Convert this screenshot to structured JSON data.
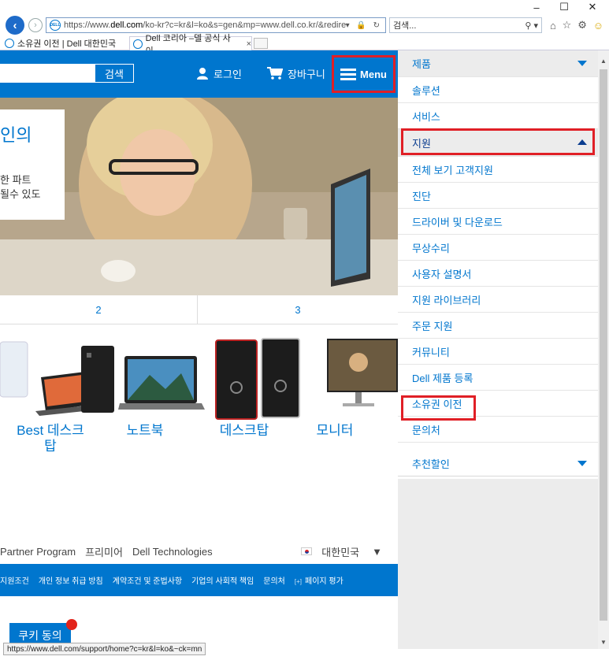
{
  "browser": {
    "url_prefix": "https://www.",
    "url_domain": "dell.com",
    "url_rest": "/ko-kr?c=kr&l=ko&s=gen&mp=www.dell.co.kr/&redirect=1#",
    "search_placeholder": "검색...",
    "window_controls": {
      "minimize": "–",
      "maximize": "☐",
      "close": "✕"
    },
    "tabs": [
      {
        "label": "소유권 이전 | Dell 대한민국"
      },
      {
        "label": "Dell 코리아 –델 공식 사이..."
      }
    ],
    "status_url": "https://www.dell.com/support/home?c=kr&l=ko&~ck=mn"
  },
  "header": {
    "search_button": "검색",
    "login": "로그인",
    "cart": "장바구니",
    "menu": "Menu"
  },
  "hero": {
    "title": "인의",
    "text": "한 파트\n될수 있도"
  },
  "carousel": {
    "items": [
      "2",
      "3"
    ]
  },
  "products": [
    {
      "label": "Best 데스크\n탑"
    },
    {
      "label": "노트북"
    },
    {
      "label": "데스크탑"
    },
    {
      "label": "모니터"
    }
  ],
  "footer": {
    "links_top": [
      "Partner Program",
      "프리미어",
      "Dell Technologies"
    ],
    "region": "대한민국",
    "links_bottom": [
      "지원조건",
      "개인 정보 취급 방침",
      "계약조건 및 준법사항",
      "기업의 사회적 책임",
      "문의처",
      "페이지 평가"
    ],
    "feedback_icon": "[+]"
  },
  "cookie": {
    "label": "쿠키 동의"
  },
  "menu": {
    "top_items": [
      {
        "label": "제품"
      },
      {
        "label": "솔루션"
      },
      {
        "label": "서비스"
      },
      {
        "label": "지원"
      }
    ],
    "support_items": [
      {
        "label": "전체 보기 고객지원"
      },
      {
        "label": "진단"
      },
      {
        "label": "드라이버 및 다운로드"
      },
      {
        "label": "무상수리"
      },
      {
        "label": "사용자 설명서"
      },
      {
        "label": "지원 라이브러리"
      },
      {
        "label": "주문 지원"
      },
      {
        "label": "커뮤니티"
      },
      {
        "label": "Dell 제품 등록"
      },
      {
        "label": "소유권 이전"
      },
      {
        "label": "문의처"
      }
    ],
    "after_item": {
      "label": "추천할인"
    }
  },
  "colors": {
    "dell_blue": "#0076ce",
    "highlight_red": "#e01f26"
  }
}
